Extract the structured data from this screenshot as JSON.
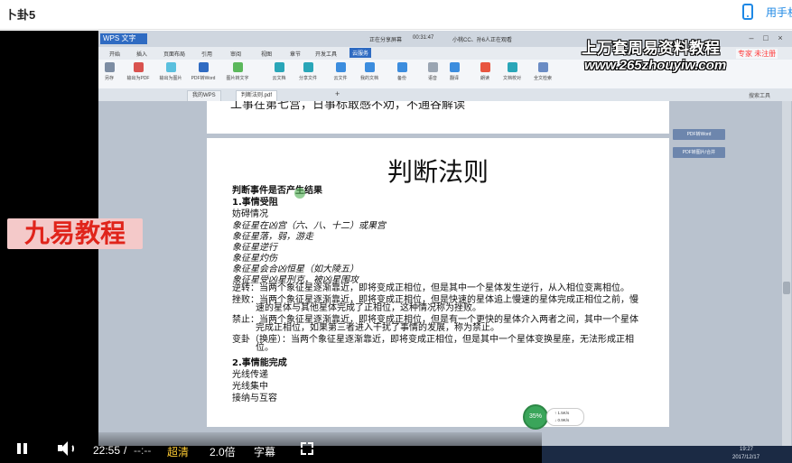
{
  "header": {
    "title": "卜卦5",
    "manual_link": "用手机"
  },
  "wps": {
    "app_label": "WPS 文字",
    "share_status": "正在分享屏幕",
    "share_time": "00:31:47",
    "viewer_text": "小桃CC、孙6人正在观看",
    "menu": [
      "开始",
      "插入",
      "页面布局",
      "引用",
      "审阅",
      "视图",
      "章节",
      "开发工具",
      "云服务"
    ],
    "menu_active_index": 8,
    "ribbon": [
      "另存",
      "输出为PDF",
      "输出为图片",
      "PDF转Word",
      "图片转文字",
      "云文档",
      "分享文件",
      "云文件",
      "我的文档",
      "备份",
      "语音",
      "翻译",
      "朗读",
      "文档校对",
      "全文检索"
    ],
    "tabs": [
      "我的WPS",
      "判断法则.pdf"
    ],
    "search_hint": "搜索工具"
  },
  "document": {
    "prev_line": "工事在第七宫，日事标敢感不劝，不通谷解读",
    "title": "判断法则",
    "heading1": "判断事件是否产生结果",
    "section1": "1.事情受阻",
    "sub1": "妨碍情况",
    "italic_lines": [
      "象征星在凶宫（六、八、十二）或果宫",
      "象征星落，弱，游走",
      "象征星逆行",
      "象征星灼伤",
      "象征星会合凶恒星（如大陵五）",
      "象征星受凶星刑克，被凶星围攻"
    ],
    "para_retro_1": "逆转：当两个象征星逐渐靠近，即将变成正相位，但是其中一个星体发生逆行，从入相位变离相位。",
    "para_frustration_1": "挫败：当两个象征星逐渐靠近，即将变成正相位，但是快速的星体追上慢速的星体完成正相位之前，慢",
    "para_frustration_2": "速的星体与其他星体完成了正相位，这种情况称为挫败。",
    "para_prohibition_1": "禁止：当两个象征星逐渐靠近，即将变成正相位，但是有一个更快的星体介入两者之间，其中一个星体",
    "para_prohibition_2": "完成正相位，如果第三者进入干扰了事情的发展，称为禁止。",
    "para_change_1": "变卦（换座）：当两个象征星逐渐靠近，即将变成正相位，但是其中一个星体变换星座，无法形成正相",
    "para_change_2": "位。",
    "section2": "2.事情能完成",
    "list2": [
      "光线传递",
      "光线集中",
      "接纳与互容"
    ]
  },
  "side_buttons": [
    "PDF转Word",
    "PDF转图片/合并"
  ],
  "network_widget": {
    "percent": "35%",
    "up": "↑ 1.5K/s",
    "down": "↓ 0.9K/s"
  },
  "taskbar": {
    "time": "19:27",
    "date": "2017/12/17"
  },
  "watermark": {
    "title": "上万套周易资料教程",
    "url": "www.265zhouyiw.com",
    "expert": "专家 未注册"
  },
  "logo_text": "九易教程",
  "player": {
    "current_time": "22:55",
    "separator": "/",
    "total_time": "--:--",
    "quality": "超清",
    "speed": "2.0倍",
    "subtitle": "字幕"
  },
  "colors": {
    "accent": "#1e88e5",
    "wps_blue": "#2f6bc2",
    "quality_yellow": "#ffcc33",
    "logo_red": "#e0241b"
  }
}
